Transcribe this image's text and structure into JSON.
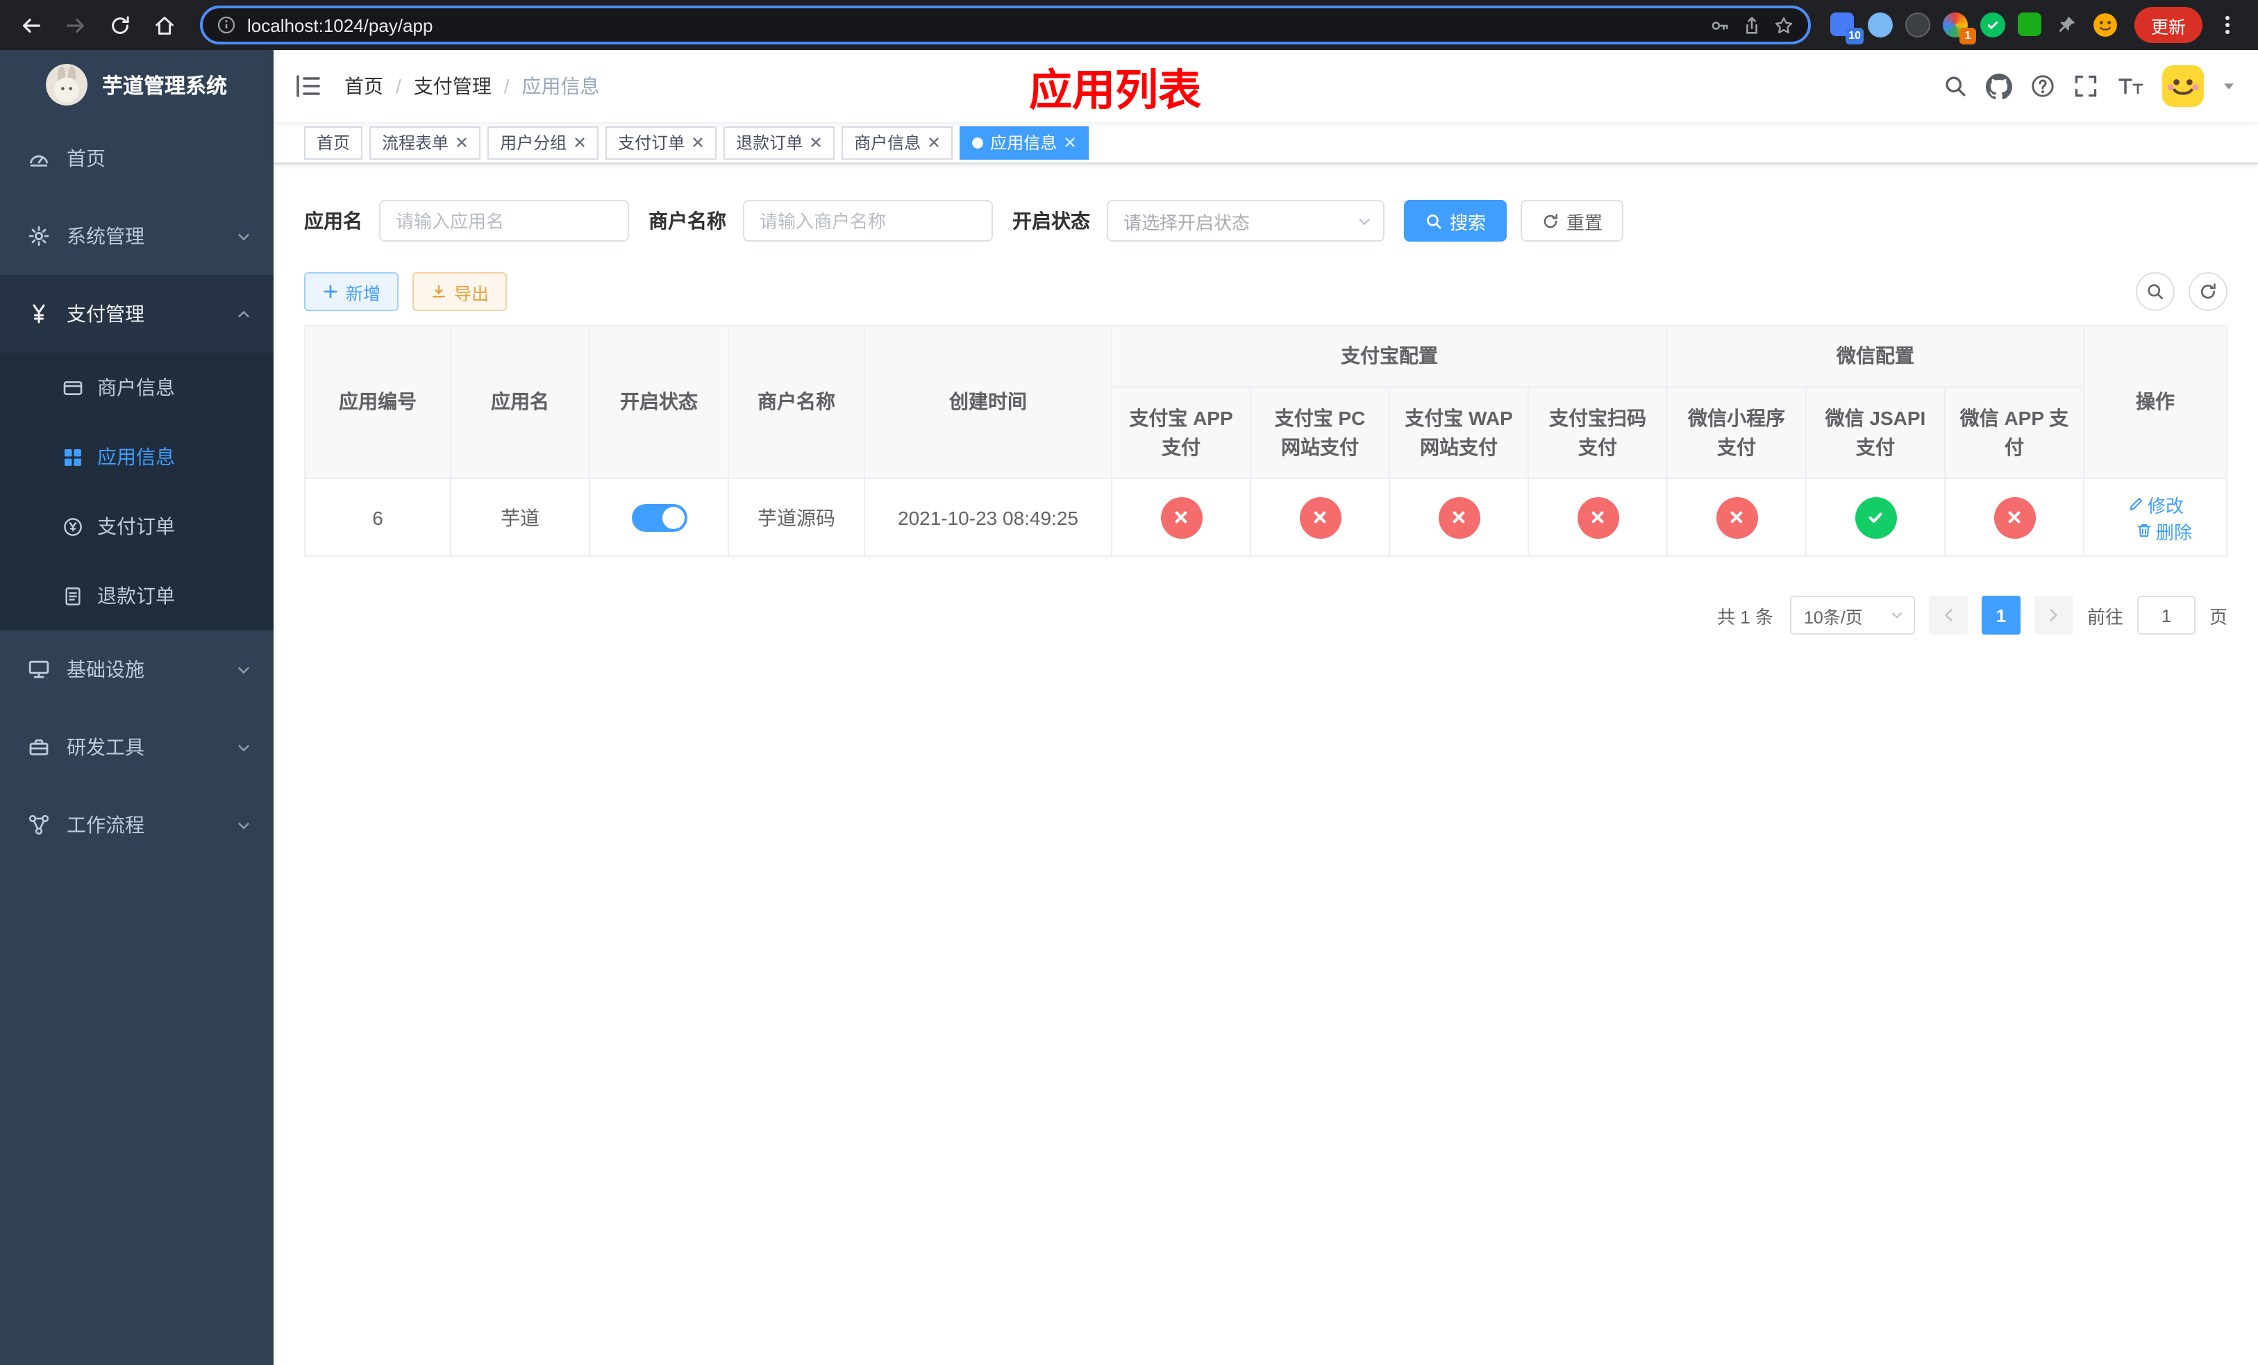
{
  "colors": {
    "accent": "#409eff",
    "danger": "#f56c6c",
    "success": "#13ce66",
    "warning": "#e6a23c",
    "annotation": "#ff0000",
    "sidebar_bg": "#304156",
    "sidebar_submenu_bg": "#1f2d3d",
    "active_tab_bg": "#409eff",
    "update_pill_bg": "#d93025"
  },
  "browser": {
    "url": "localhost:1024/pay/app",
    "update_button_label": "更新",
    "extensions": [
      {
        "name": "extension-blue",
        "badge": "10"
      },
      {
        "name": "extension-lightblue"
      },
      {
        "name": "extension-dark"
      },
      {
        "name": "extension-colorful",
        "badge": "1"
      },
      {
        "name": "extension-green-circle"
      },
      {
        "name": "extension-green-square"
      },
      {
        "name": "extension-pin"
      },
      {
        "name": "extension-emoji"
      }
    ]
  },
  "sidebar": {
    "title": "芋道管理系统",
    "menu": [
      {
        "label": "首页",
        "icon": "gauge-icon"
      },
      {
        "label": "系统管理",
        "icon": "gear-icon",
        "expandable": true
      },
      {
        "label": "支付管理",
        "icon": "yen-icon",
        "expandable": true,
        "expanded": true,
        "children": [
          {
            "label": "商户信息",
            "icon": "credit-card-icon"
          },
          {
            "label": "应用信息",
            "icon": "grid-icon",
            "active": true
          },
          {
            "label": "支付订单",
            "icon": "coin-icon"
          },
          {
            "label": "退款订单",
            "icon": "document-icon"
          }
        ]
      },
      {
        "label": "基础设施",
        "icon": "monitor-icon",
        "expandable": true
      },
      {
        "label": "研发工具",
        "icon": "toolbox-icon",
        "expandable": true
      },
      {
        "label": "工作流程",
        "icon": "workflow-icon",
        "expandable": true
      }
    ]
  },
  "header": {
    "breadcrumb": [
      "首页",
      "支付管理",
      "应用信息"
    ],
    "annotation": "应用列表"
  },
  "tabs": [
    {
      "label": "首页",
      "closable": false,
      "active": false
    },
    {
      "label": "流程表单",
      "closable": true,
      "active": false
    },
    {
      "label": "用户分组",
      "closable": true,
      "active": false
    },
    {
      "label": "支付订单",
      "closable": true,
      "active": false
    },
    {
      "label": "退款订单",
      "closable": true,
      "active": false
    },
    {
      "label": "商户信息",
      "closable": true,
      "active": false
    },
    {
      "label": "应用信息",
      "closable": true,
      "active": true
    }
  ],
  "filters": {
    "app_name_label": "应用名",
    "app_name_placeholder": "请输入应用名",
    "merchant_label": "商户名称",
    "merchant_placeholder": "请输入商户名称",
    "status_label": "开启状态",
    "status_placeholder": "请选择开启状态",
    "search_button": "搜索",
    "reset_button": "重置"
  },
  "toolbar": {
    "add_button": "新增",
    "export_button": "导出"
  },
  "table": {
    "fixed_columns": [
      "应用编号",
      "应用名",
      "开启状态",
      "商户名称",
      "创建时间"
    ],
    "groups": [
      {
        "label": "支付宝配置",
        "columns": [
          "支付宝 APP 支付",
          "支付宝 PC 网站支付",
          "支付宝 WAP 网站支付",
          "支付宝扫码支付"
        ]
      },
      {
        "label": "微信配置",
        "columns": [
          "微信小程序支付",
          "微信 JSAPI 支付",
          "微信 APP 支付"
        ]
      }
    ],
    "actions_column": "操作",
    "rows": [
      {
        "app_id": "6",
        "app_name": "芋道",
        "enabled": true,
        "merchant_name": "芋道源码",
        "create_time": "2021-10-23 08:49:25",
        "pay_statuses": [
          false,
          false,
          false,
          false,
          false,
          true,
          false
        ],
        "edit_label": "修改",
        "delete_label": "删除"
      }
    ]
  },
  "pagination": {
    "total_text": "共 1 条",
    "page_size": "10条/页",
    "current_page": "1",
    "goto_label": "前往",
    "goto_value": "1",
    "page_unit": "页"
  }
}
